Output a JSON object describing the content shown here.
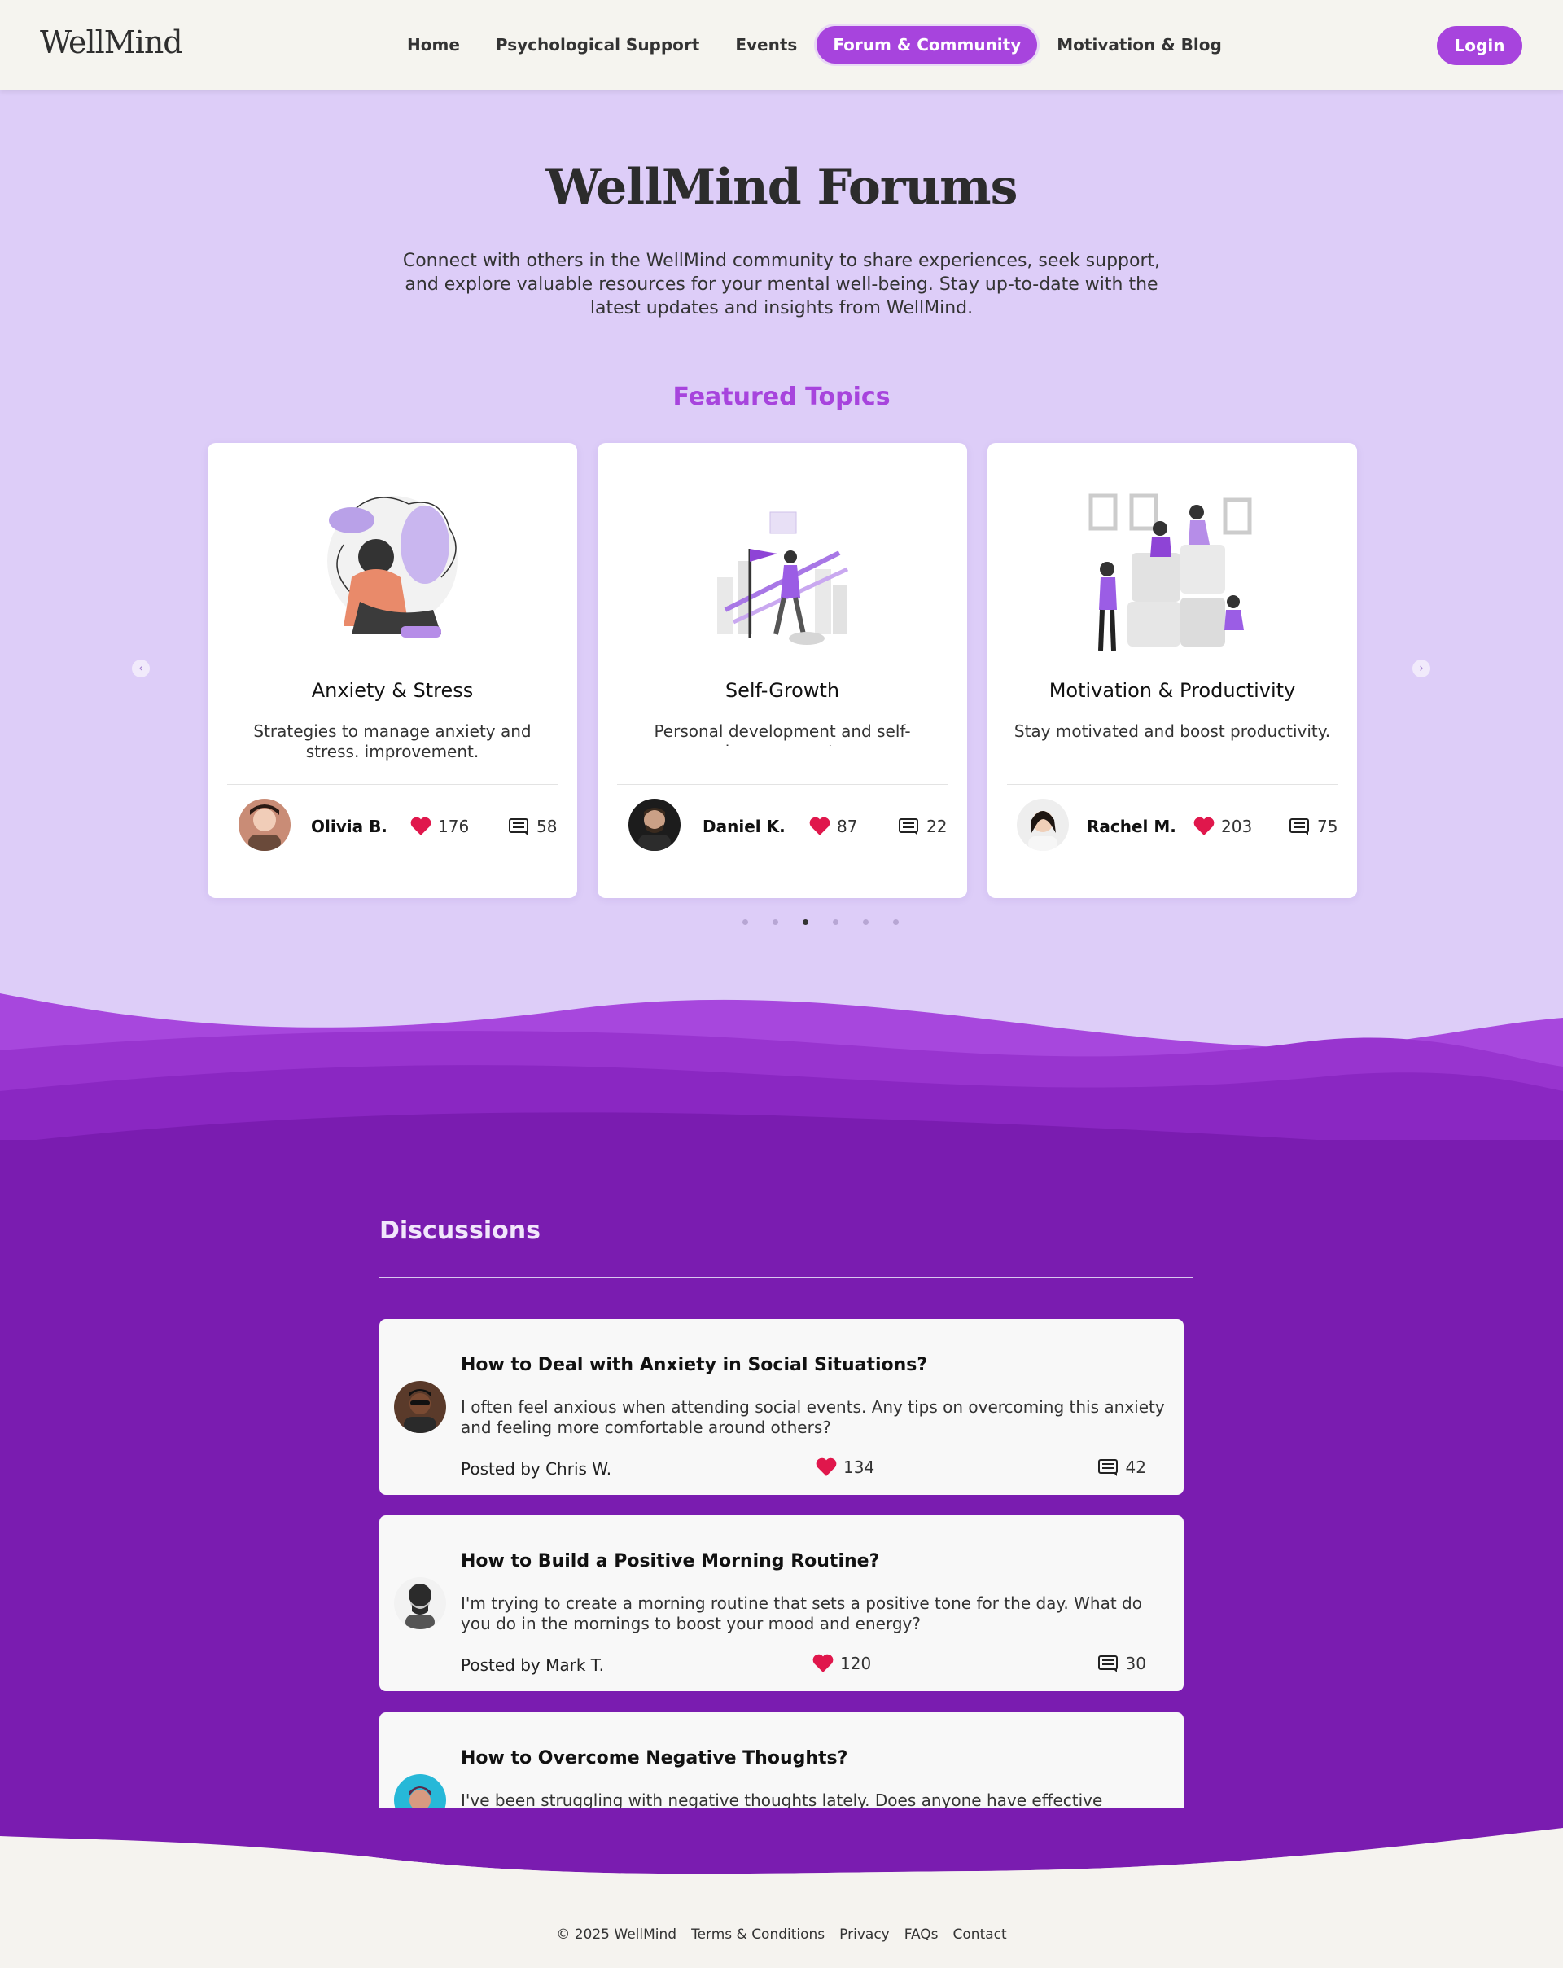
{
  "brand": "WellMind",
  "nav": {
    "links": [
      {
        "label": "Home",
        "active": false
      },
      {
        "label": "Psychological Support",
        "active": false
      },
      {
        "label": "Events",
        "active": false
      },
      {
        "label": "Forum & Community",
        "active": true
      },
      {
        "label": "Motivation & Blog",
        "active": false
      }
    ],
    "login_label": "Login"
  },
  "hero": {
    "title": "WellMind Forums",
    "description": "Connect with others in the WellMind community to share experiences, seek support, and explore valuable resources for your mental well-being. Stay up-to-date with the latest updates and insights from WellMind."
  },
  "featured": {
    "title": "Featured Topics",
    "cards": [
      {
        "title": "Anxiety & Stress",
        "description": "Strategies to manage anxiety and stress. improvement.",
        "author": "Olivia B.",
        "likes": "176",
        "comments": "58"
      },
      {
        "title": "Self-Growth",
        "description": "Personal development and self-improvement.",
        "author": "Daniel K.",
        "likes": "87",
        "comments": "22"
      },
      {
        "title": "Motivation & Productivity",
        "description": "Stay motivated and boost productivity.",
        "author": "Rachel M.",
        "likes": "203",
        "comments": "75"
      }
    ],
    "dots_count": 6,
    "active_dot": 2
  },
  "discussions": {
    "title": "Discussions",
    "posts": [
      {
        "title": "How to Deal with Anxiety in Social Situations?",
        "body": "I often feel anxious when attending social events. Any tips on overcoming this anxiety and feeling more comfortable around others?",
        "posted_by": "Posted by Chris W.",
        "likes": "134",
        "comments": "42"
      },
      {
        "title": "How to Build a Positive Morning Routine?",
        "body": "I'm trying to create a morning routine that sets a positive tone for the day. What do you do in the mornings to boost your mood and energy?",
        "posted_by": "Posted by Mark T.",
        "likes": "120",
        "comments": "30"
      },
      {
        "title": "How to Overcome Negative Thoughts?",
        "body": "I've been struggling with negative thoughts lately. Does anyone have effective techniques",
        "posted_by": "",
        "likes": "",
        "comments": ""
      }
    ]
  },
  "footer": {
    "copyright": "© 2025 WellMind",
    "links": [
      "Terms & Conditions",
      "Privacy",
      "FAQs",
      "Contact"
    ]
  },
  "colors": {
    "accent": "#a744dd",
    "hero_bg": "#ddcdf8",
    "discussions_bg": "#7a1cb0",
    "heart": "#e0174c"
  }
}
